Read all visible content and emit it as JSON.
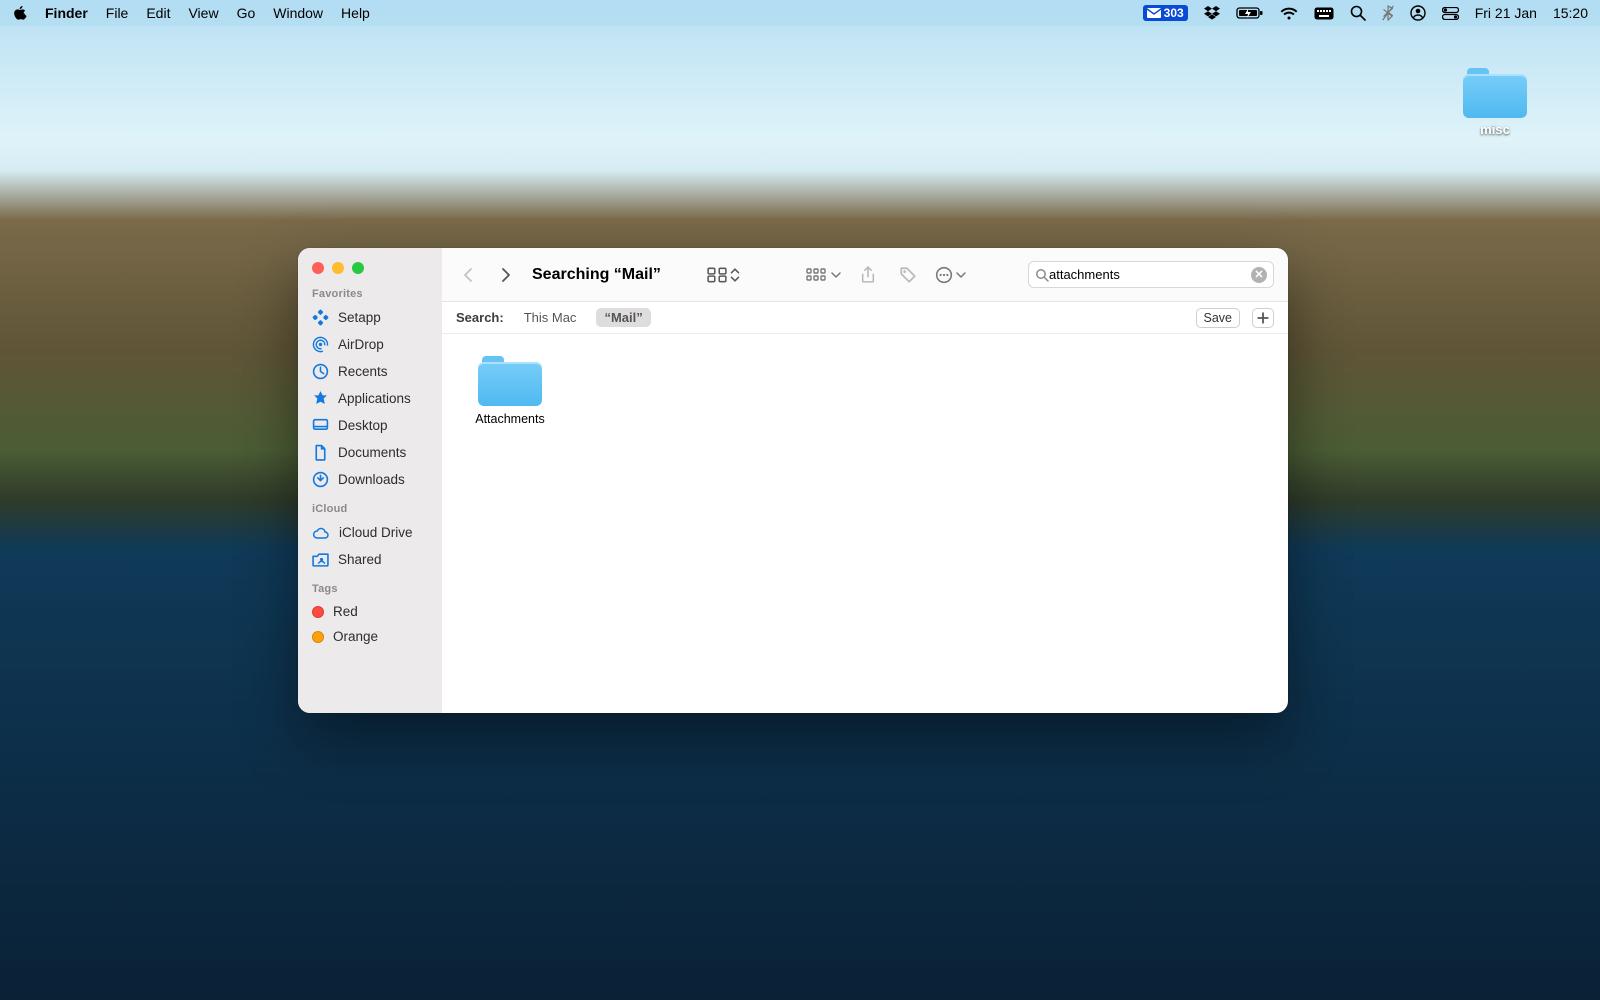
{
  "menubar": {
    "app": "Finder",
    "items": [
      "File",
      "Edit",
      "View",
      "Go",
      "Window",
      "Help"
    ],
    "mail_count": "303",
    "date": "Fri 21 Jan",
    "time": "15:20"
  },
  "desktop": {
    "folder_label": "misc"
  },
  "finder": {
    "title": "Searching “Mail”",
    "search_value": "attachments",
    "scope": {
      "label": "Search:",
      "items": [
        {
          "label": "This Mac",
          "active": false
        },
        {
          "label": "“Mail”",
          "active": true
        }
      ],
      "save_label": "Save"
    },
    "sidebar": {
      "sections": [
        {
          "heading": "Favorites",
          "items": [
            {
              "icon": "setapp",
              "label": "Setapp"
            },
            {
              "icon": "airdrop",
              "label": "AirDrop"
            },
            {
              "icon": "clock",
              "label": "Recents"
            },
            {
              "icon": "apps",
              "label": "Applications"
            },
            {
              "icon": "desktop",
              "label": "Desktop"
            },
            {
              "icon": "doc",
              "label": "Documents"
            },
            {
              "icon": "download",
              "label": "Downloads"
            }
          ]
        },
        {
          "heading": "iCloud",
          "items": [
            {
              "icon": "cloud",
              "label": "iCloud Drive"
            },
            {
              "icon": "shared",
              "label": "Shared"
            }
          ]
        },
        {
          "heading": "Tags",
          "items": [
            {
              "icon": "tag",
              "label": "Red",
              "color": "#ff4b3f"
            },
            {
              "icon": "tag",
              "label": "Orange",
              "color": "#ff9f0a"
            }
          ]
        }
      ]
    },
    "results": [
      {
        "name": "Attachments"
      }
    ]
  }
}
